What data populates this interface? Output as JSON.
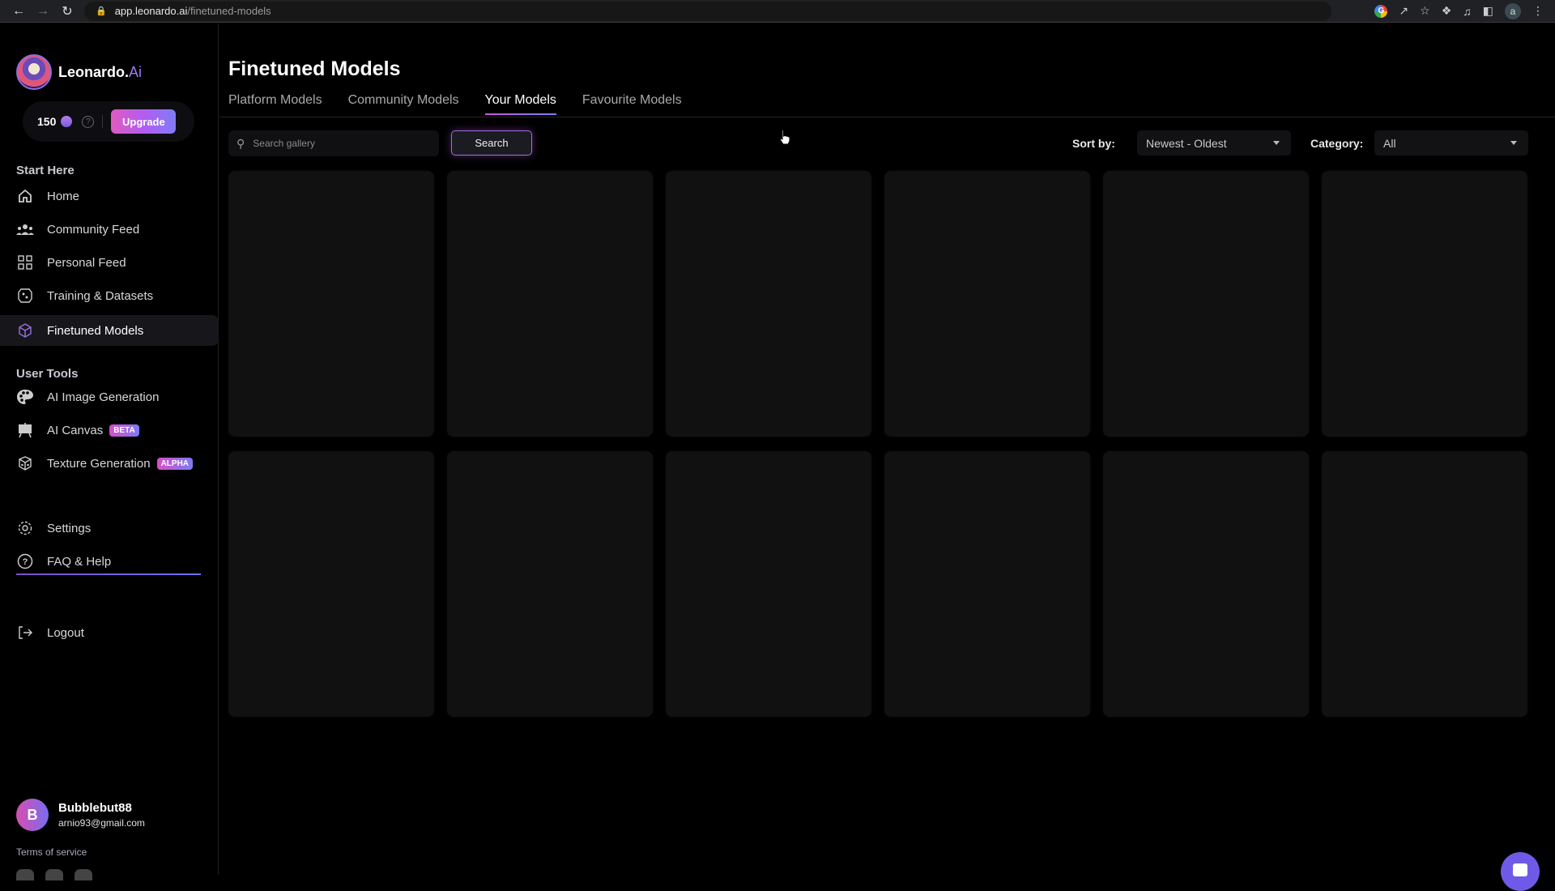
{
  "browser": {
    "url_host": "app.leonardo.ai",
    "url_path": "/finetuned-models",
    "profile_initial": "a"
  },
  "brand": {
    "name": "Leonardo.",
    "suffix": "Ai"
  },
  "credits": {
    "amount": "150",
    "upgrade_label": "Upgrade",
    "help_glyph": "?"
  },
  "sidebar": {
    "start_here_title": "Start Here",
    "start_items": [
      {
        "label": "Home",
        "icon": "home-icon"
      },
      {
        "label": "Community Feed",
        "icon": "community-icon"
      },
      {
        "label": "Personal Feed",
        "icon": "grid-icon"
      },
      {
        "label": "Training & Datasets",
        "icon": "training-icon"
      },
      {
        "label": "Finetuned Models",
        "icon": "cube-icon",
        "active": true
      }
    ],
    "user_tools_title": "User Tools",
    "tool_items": [
      {
        "label": "AI Image Generation",
        "icon": "palette-icon"
      },
      {
        "label": "AI Canvas",
        "icon": "easel-icon",
        "badge": "BETA"
      },
      {
        "label": "Texture Generation",
        "icon": "texture-cube-icon",
        "badge": "ALPHA"
      }
    ],
    "bottom_items": [
      {
        "label": "Settings",
        "icon": "gear-icon"
      },
      {
        "label": "FAQ & Help",
        "icon": "help-circle-icon"
      }
    ],
    "logout_label": "Logout",
    "user": {
      "initial": "B",
      "name": "Bubblebut88",
      "email": "arnio93@gmail.com"
    },
    "terms_label": "Terms of service"
  },
  "main": {
    "title": "Finetuned Models",
    "tabs": [
      {
        "label": "Platform Models"
      },
      {
        "label": "Community Models"
      },
      {
        "label": "Your Models",
        "active": true
      },
      {
        "label": "Favourite Models"
      }
    ],
    "search": {
      "placeholder": "Search gallery",
      "value": "",
      "button_label": "Search"
    },
    "sort": {
      "label": "Sort by:",
      "value": "Newest - Oldest"
    },
    "category": {
      "label": "Category:",
      "value": "All"
    },
    "placeholder_cards": 12
  },
  "colors": {
    "accent_purple": "#9d7cf0",
    "upgrade_gradient_start": "#e05bc0",
    "upgrade_gradient_end": "#7f7cf8",
    "chat_button": "#6f5ae8"
  }
}
